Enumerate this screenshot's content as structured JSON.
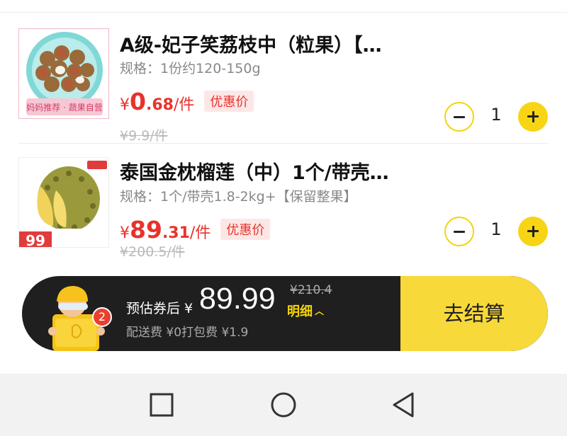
{
  "cart": {
    "items": [
      {
        "title": "A级-妃子笑荔枝中（粒果）【…",
        "spec": "规格：1份约120-150g",
        "price_yen": "¥",
        "price_int": "0",
        "price_dec": ".68",
        "price_unit": "/件",
        "badge": "优惠价",
        "old_price": "¥9.9/件",
        "quantity": "1",
        "image_icon": "lychee-product-image",
        "image_caption": "妈妈推荐 · 蔬果自营"
      },
      {
        "title": "泰国金枕榴莲（中）1个/带壳…",
        "spec": "规格：1个/带壳1.8-2kg+【保留整果】",
        "price_yen": "¥",
        "price_int": "89",
        "price_dec": ".31",
        "price_unit": "/件",
        "badge": "优惠价",
        "old_price": "¥200.5/件",
        "quantity": "1",
        "image_icon": "durian-product-image",
        "image_caption": "99"
      }
    ]
  },
  "summary": {
    "est_label": "预估券后 ¥",
    "est_price": "89.99",
    "old_total": "¥210.4",
    "detail_label": "明细",
    "fees": "配送费 ¥0打包费 ¥1.9",
    "cart_count": "2",
    "checkout_label": "去结算",
    "accent_color": "#f8d93a",
    "price_color": "#e8322b"
  },
  "nav": {
    "recent_icon": "square-recent-apps-icon",
    "home_icon": "circle-home-icon",
    "back_icon": "triangle-back-icon"
  }
}
